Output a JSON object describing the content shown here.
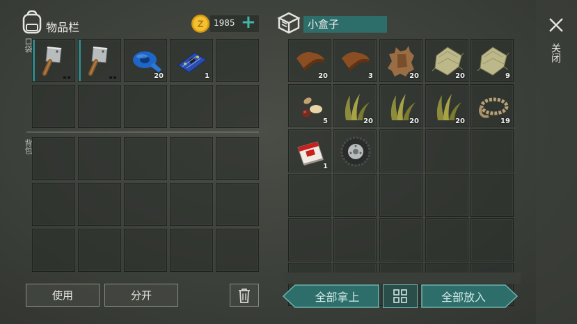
{
  "inventory": {
    "title": "物品栏",
    "coins": "1985",
    "coin_symbol": "Z",
    "add_symbol": "+",
    "pocket_label": "口袋",
    "backpack_label": "背包",
    "pocket_slots": [
      {
        "icon": "cleaver-icon",
        "count": "",
        "equipped": true
      },
      {
        "icon": "cleaver-icon",
        "count": "",
        "equipped": true
      },
      {
        "icon": "blue-tape-icon",
        "count": "20"
      },
      {
        "icon": "circuit-board-icon",
        "count": "1"
      },
      {
        "icon": "",
        "count": ""
      }
    ],
    "use_label": "使用",
    "split_label": "分开"
  },
  "container": {
    "name": "小盒子",
    "close_label": "关闭",
    "items": [
      {
        "icon": "leather-icon",
        "count": "20"
      },
      {
        "icon": "leather-icon",
        "count": "3"
      },
      {
        "icon": "animal-hide-icon",
        "count": "20"
      },
      {
        "icon": "cloth-icon",
        "count": "20"
      },
      {
        "icon": "cloth-icon",
        "count": "9"
      },
      {
        "icon": "seeds-icon",
        "count": "5"
      },
      {
        "icon": "plant-fiber-icon",
        "count": "20"
      },
      {
        "icon": "plant-fiber-icon",
        "count": "20"
      },
      {
        "icon": "plant-fiber-icon",
        "count": "20"
      },
      {
        "icon": "rope-icon",
        "count": "19"
      },
      {
        "icon": "cigarettes-icon",
        "count": "1"
      },
      {
        "icon": "tire-icon",
        "count": ""
      }
    ],
    "take_all_label": "全部拿上",
    "put_all_label": "全部放入"
  },
  "colors": {
    "accent": "#2e6e6a",
    "coin": "#e0b020",
    "plus": "#3fb8a8"
  }
}
